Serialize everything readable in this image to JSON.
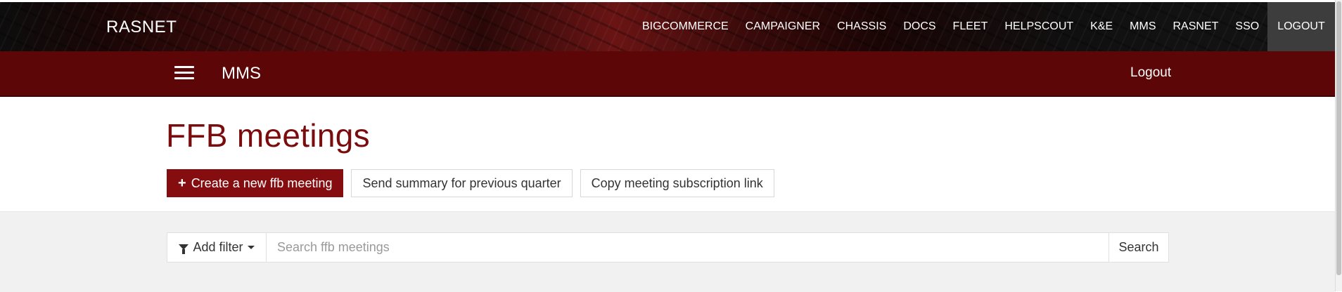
{
  "topnav": {
    "brand": "RASNET",
    "links": [
      "BIGCOMMERCE",
      "CAMPAIGNER",
      "CHASSIS",
      "DOCS",
      "FLEET",
      "HELPSCOUT",
      "K&E",
      "MMS",
      "RASNET",
      "SSO",
      "LOGOUT"
    ]
  },
  "subnav": {
    "title": "MMS",
    "logout": "Logout"
  },
  "page": {
    "title": "FFB meetings"
  },
  "actions": {
    "create_label": "Create a new ffb meeting",
    "summary_label": "Send summary for previous quarter",
    "copy_label": "Copy meeting subscription link"
  },
  "filter": {
    "add_filter_label": "Add filter",
    "search_placeholder": "Search ffb meetings",
    "search_button": "Search"
  },
  "icons": {
    "menu": "hamburger-icon",
    "plus": "plus-icon",
    "filter": "funnel-icon",
    "dropdown": "caret-down-icon"
  },
  "colors": {
    "brand_red": "#850d10",
    "subnav_red": "#5c0608",
    "title_red": "#7a0c0e"
  }
}
